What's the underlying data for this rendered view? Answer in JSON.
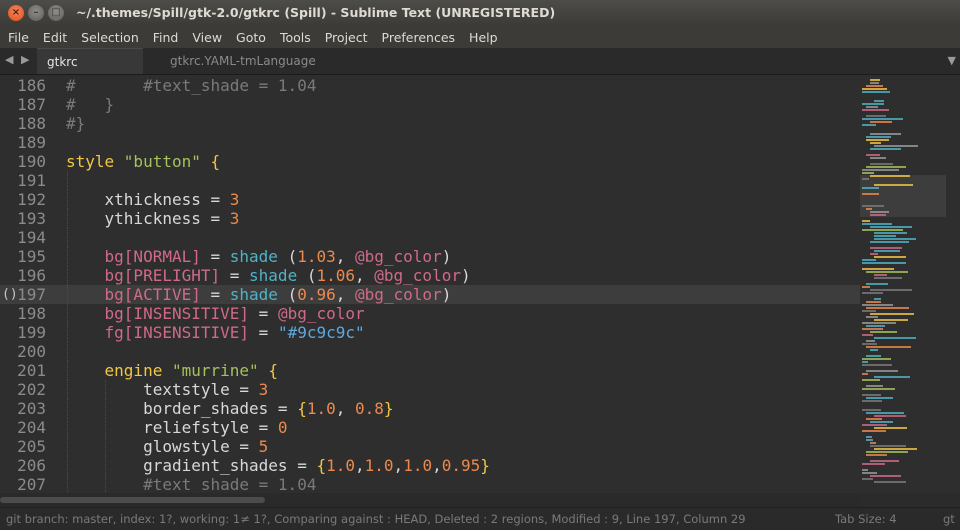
{
  "window": {
    "title": "~/.themes/Spill/gtk-2.0/gtkrc (Spill) - Sublime Text (UNREGISTERED)",
    "close_glyph": "×",
    "min_glyph": "–",
    "max_glyph": "□"
  },
  "menu": [
    "File",
    "Edit",
    "Selection",
    "Find",
    "View",
    "Goto",
    "Tools",
    "Project",
    "Preferences",
    "Help"
  ],
  "tabs": {
    "nav_left": "◀",
    "nav_right": "▶",
    "active": "gtkrc",
    "inactive": "gtkrc.YAML-tmLanguage",
    "menu_glyph": "▼"
  },
  "editor": {
    "current_line": 197,
    "fold_marker": "()",
    "lines": [
      {
        "num": "186",
        "tokens": [
          [
            "c-comment",
            "#       #text_shade = 1.04"
          ]
        ]
      },
      {
        "num": "187",
        "tokens": [
          [
            "c-comment",
            "#   }"
          ]
        ]
      },
      {
        "num": "188",
        "tokens": [
          [
            "c-comment",
            "#}"
          ]
        ]
      },
      {
        "num": "189",
        "tokens": []
      },
      {
        "num": "190",
        "tokens": [
          [
            "c-kw",
            "style "
          ],
          [
            "c-str",
            "\"button\""
          ],
          [
            "c-op",
            " "
          ],
          [
            "c-brace",
            "{"
          ]
        ]
      },
      {
        "num": "191",
        "tokens": []
      },
      {
        "num": "192",
        "tokens": [
          [
            "c-op",
            "    xthickness = "
          ],
          [
            "c-num",
            "3"
          ]
        ]
      },
      {
        "num": "193",
        "tokens": [
          [
            "c-op",
            "    ythickness = "
          ],
          [
            "c-num",
            "3"
          ]
        ]
      },
      {
        "num": "194",
        "tokens": []
      },
      {
        "num": "195",
        "tokens": [
          [
            "c-prop",
            "    bg[NORMAL]"
          ],
          [
            "c-op",
            " = "
          ],
          [
            "c-fn",
            "shade"
          ],
          [
            "c-op",
            " ("
          ],
          [
            "c-num",
            "1.03"
          ],
          [
            "c-op",
            ", "
          ],
          [
            "c-var",
            "@bg_color"
          ],
          [
            "c-op",
            ")"
          ]
        ]
      },
      {
        "num": "196",
        "tokens": [
          [
            "c-prop",
            "    bg[PRELIGHT]"
          ],
          [
            "c-op",
            " = "
          ],
          [
            "c-fn",
            "shade"
          ],
          [
            "c-op",
            " ("
          ],
          [
            "c-num",
            "1.06"
          ],
          [
            "c-op",
            ", "
          ],
          [
            "c-var",
            "@bg_color"
          ],
          [
            "c-op",
            ")"
          ]
        ]
      },
      {
        "num": "197",
        "tokens": [
          [
            "c-prop",
            "    bg[ACTIVE]"
          ],
          [
            "c-op",
            " = "
          ],
          [
            "c-fn",
            "shade"
          ],
          [
            "c-op",
            " ("
          ],
          [
            "c-num",
            "0.96"
          ],
          [
            "c-op",
            ", "
          ],
          [
            "c-var",
            "@bg_color"
          ],
          [
            "c-op",
            ")"
          ]
        ]
      },
      {
        "num": "198",
        "tokens": [
          [
            "c-prop",
            "    bg[INSENSITIVE]"
          ],
          [
            "c-op",
            " = "
          ],
          [
            "c-var",
            "@bg_color"
          ]
        ]
      },
      {
        "num": "199",
        "tokens": [
          [
            "c-prop",
            "    fg[INSENSITIVE]"
          ],
          [
            "c-op",
            " = "
          ],
          [
            "c-strblue",
            "\"#9c9c9c\""
          ]
        ]
      },
      {
        "num": "200",
        "tokens": []
      },
      {
        "num": "201",
        "tokens": [
          [
            "c-kw",
            "    engine "
          ],
          [
            "c-str",
            "\"murrine\""
          ],
          [
            "c-op",
            " "
          ],
          [
            "c-brace",
            "{"
          ]
        ]
      },
      {
        "num": "202",
        "tokens": [
          [
            "c-op",
            "        textstyle = "
          ],
          [
            "c-num",
            "3"
          ]
        ]
      },
      {
        "num": "203",
        "tokens": [
          [
            "c-op",
            "        border_shades = "
          ],
          [
            "c-brace",
            "{"
          ],
          [
            "c-num",
            "1.0"
          ],
          [
            "c-op",
            ", "
          ],
          [
            "c-num",
            "0.8"
          ],
          [
            "c-brace",
            "}"
          ]
        ]
      },
      {
        "num": "204",
        "tokens": [
          [
            "c-op",
            "        reliefstyle = "
          ],
          [
            "c-num",
            "0"
          ]
        ]
      },
      {
        "num": "205",
        "tokens": [
          [
            "c-op",
            "        glowstyle = "
          ],
          [
            "c-num",
            "5"
          ]
        ]
      },
      {
        "num": "206",
        "tokens": [
          [
            "c-op",
            "        gradient_shades = "
          ],
          [
            "c-brace",
            "{"
          ],
          [
            "c-num",
            "1.0"
          ],
          [
            "c-op",
            ","
          ],
          [
            "c-num",
            "1.0"
          ],
          [
            "c-op",
            ","
          ],
          [
            "c-num",
            "1.0"
          ],
          [
            "c-op",
            ","
          ],
          [
            "c-num",
            "0.95"
          ],
          [
            "c-brace",
            "}"
          ]
        ]
      },
      {
        "num": "207",
        "tokens": [
          [
            "c-comment",
            "        #text_shade = 1.04"
          ]
        ]
      }
    ]
  },
  "status": {
    "left": "git branch: master, index: 1?, working: 1≠ 1?, Comparing against : HEAD, Deleted : 2 regions, Modified : 9, Line 197, Column 29",
    "tab_size": "Tab Size: 4",
    "syntax": "gt"
  }
}
